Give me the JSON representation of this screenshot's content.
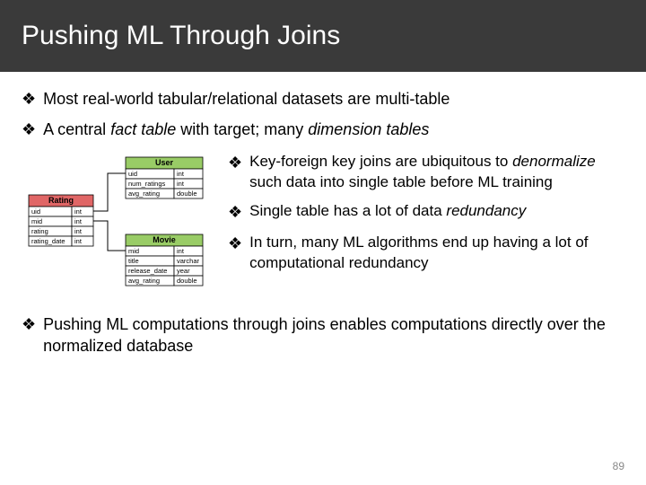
{
  "title": "Pushing ML Through Joins",
  "bullets_top": [
    {
      "prefix": "Most real-world tabular/relational datasets are multi-table",
      "italic": "",
      "suffix": ""
    },
    {
      "prefix": "A central ",
      "italic": "fact table",
      "suffix": " with target; many ",
      "italic2": "dimension tables"
    }
  ],
  "bullets_mid": [
    {
      "pre": "Key-foreign key joins are ubiquitous to ",
      "it": "denormalize",
      "post": " such data into single table before ML training"
    },
    {
      "pre": "Single table has a lot of data ",
      "it": "redundancy",
      "post": ""
    },
    {
      "pre": "In turn, many ML algorithms end up having a lot of computational redundancy",
      "it": "",
      "post": ""
    }
  ],
  "bullet_bottom": "Pushing ML computations through joins enables computations directly over the normalized database",
  "page_number": "89",
  "glyph": "❖",
  "diagram": {
    "rating": {
      "title": "Rating",
      "rows": [
        [
          "uid",
          "int"
        ],
        [
          "mid",
          "int"
        ],
        [
          "rating",
          "int"
        ],
        [
          "rating_date",
          "int"
        ]
      ]
    },
    "user": {
      "title": "User",
      "rows": [
        [
          "uid",
          "int"
        ],
        [
          "num_ratings",
          "int"
        ],
        [
          "avg_rating",
          "double"
        ]
      ]
    },
    "movie": {
      "title": "Movie",
      "rows": [
        [
          "mid",
          "int"
        ],
        [
          "title",
          "varchar"
        ],
        [
          "release_date",
          "year"
        ],
        [
          "avg_rating",
          "double"
        ]
      ]
    }
  }
}
